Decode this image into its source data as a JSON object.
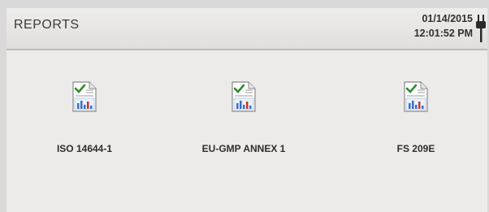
{
  "header": {
    "title": "REPORTS",
    "date": "01/14/2015",
    "time": "12:01:52 PM",
    "power_icon": "plug-icon"
  },
  "reports": [
    {
      "label": "ISO 14644-1",
      "icon": "report-document-icon"
    },
    {
      "label": "EU-GMP ANNEX 1",
      "icon": "report-document-icon"
    },
    {
      "label": "FS 209E",
      "icon": "report-document-icon"
    }
  ],
  "colors": {
    "background": "#ecebe9",
    "text": "#2e2e2e",
    "check": "#2e8b2e",
    "bar_blue": "#3a6fc4",
    "bar_red": "#c0392b"
  }
}
